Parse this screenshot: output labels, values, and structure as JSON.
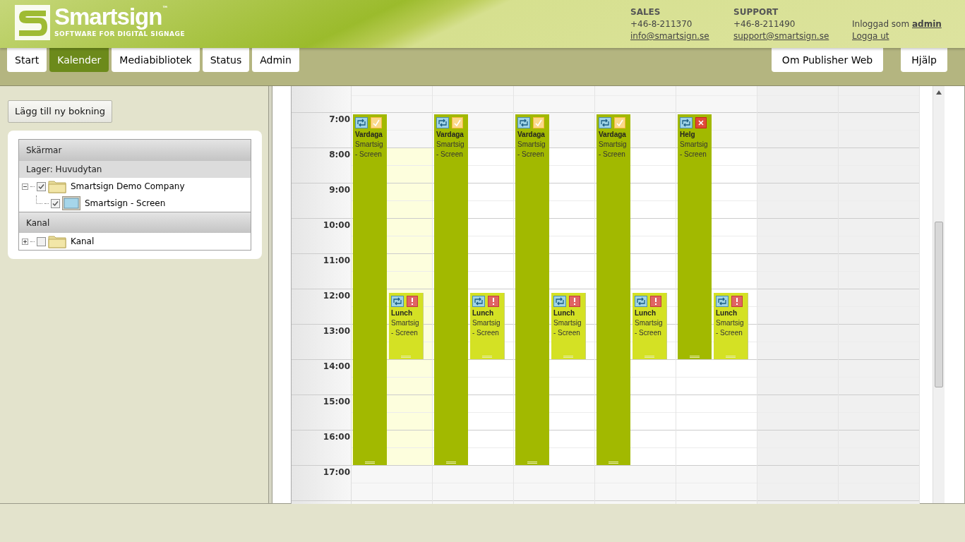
{
  "brand": {
    "name": "Smartsign",
    "trademark": "™",
    "tagline": "SOFTWARE FOR DIGITAL SIGNAGE"
  },
  "contacts": [
    {
      "heading": "SALES",
      "phone": "+46-8-211370",
      "email": "info@smartsign.se"
    },
    {
      "heading": "SUPPORT",
      "phone": "+46-8-211490",
      "email": "support@smartsign.se"
    }
  ],
  "user": {
    "prefix": "Inloggad som",
    "name": "admin",
    "logout": "Logga ut"
  },
  "nav": [
    {
      "label": "Start",
      "selected": false
    },
    {
      "label": "Kalender",
      "selected": true
    },
    {
      "label": "Mediabibliotek",
      "selected": false
    },
    {
      "label": "Status",
      "selected": false
    },
    {
      "label": "Admin",
      "selected": false
    }
  ],
  "nav_right": [
    "Om Publisher Web",
    "Hjälp"
  ],
  "sidebar": {
    "add_button": "Lägg till ny bokning",
    "sections": [
      {
        "title": "Skärmar",
        "subtitle": "Lager: Huvudytan",
        "tree": [
          {
            "label": "Smartsign Demo Company",
            "kind": "folder",
            "expanded": true,
            "checked": true,
            "children": [
              {
                "label": "Smartsign - Screen",
                "kind": "screen",
                "checked": true
              }
            ]
          }
        ]
      },
      {
        "title": "Kanal",
        "tree": [
          {
            "label": "Kanal",
            "kind": "folder",
            "expanded": false,
            "checked": false
          }
        ]
      }
    ]
  },
  "calendar": {
    "hours": [
      "7:00",
      "8:00",
      "9:00",
      "10:00",
      "11:00",
      "12:00",
      "13:00",
      "14:00",
      "15:00",
      "16:00",
      "17:00"
    ],
    "days": [
      {
        "today": true,
        "weekend": false,
        "events": [
          {
            "title": "Vardaga",
            "text": "Smartsig",
            "text2": "- Screen",
            "kind": "workday"
          },
          {
            "title": "Lunch",
            "text": "Smartsig",
            "text2": "- Screen",
            "kind": "lunch"
          }
        ]
      },
      {
        "today": false,
        "weekend": false,
        "events": [
          {
            "title": "Vardaga",
            "text": "Smartsig",
            "text2": "- Screen",
            "kind": "workday"
          },
          {
            "title": "Lunch",
            "text": "Smartsig",
            "text2": "- Screen",
            "kind": "lunch"
          }
        ]
      },
      {
        "today": false,
        "weekend": false,
        "events": [
          {
            "title": "Vardaga",
            "text": "Smartsig",
            "text2": "- Screen",
            "kind": "workday"
          },
          {
            "title": "Lunch",
            "text": "Smartsig",
            "text2": "- Screen",
            "kind": "lunch"
          }
        ]
      },
      {
        "today": false,
        "weekend": false,
        "events": [
          {
            "title": "Vardaga",
            "text": "Smartsig",
            "text2": "- Screen",
            "kind": "workday"
          },
          {
            "title": "Lunch",
            "text": "Smartsig",
            "text2": "- Screen",
            "kind": "lunch"
          }
        ]
      },
      {
        "today": false,
        "weekend": false,
        "events": [
          {
            "title": "Helg",
            "text": "Smartsig",
            "text2": "- Screen",
            "kind": "disabled"
          },
          {
            "title": "Lunch",
            "text": "Smartsig",
            "text2": "- Screen",
            "kind": "lunch"
          }
        ]
      },
      {
        "today": false,
        "weekend": true
      },
      {
        "today": false,
        "weekend": true
      }
    ]
  }
}
